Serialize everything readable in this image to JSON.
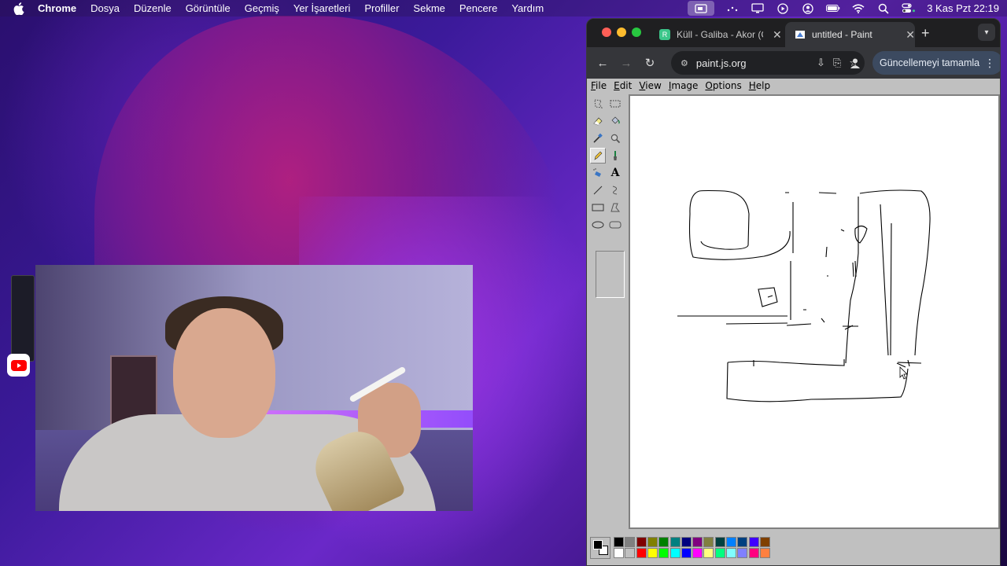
{
  "menubar": {
    "app_name": "Chrome",
    "items": [
      "Dosya",
      "Düzenle",
      "Görüntüle",
      "Geçmiş",
      "Yer İşaretleri",
      "Profiller",
      "Sekme",
      "Pencere",
      "Yardım"
    ],
    "clock": "3 Kas Pzt  22:19",
    "status_icons": [
      "screen-share-icon",
      "control-center-dots-icon",
      "display-icon",
      "play-icon",
      "user-icon",
      "battery-icon",
      "wifi-icon",
      "search-icon",
      "control-center-icon"
    ]
  },
  "browser": {
    "tabs": [
      {
        "title": "Küll - Galiba - Akor (G",
        "favicon": "R",
        "favicon_color": "#3cc68a",
        "active": false
      },
      {
        "title": "untitled - Paint",
        "favicon": "paint-icon",
        "active": true
      }
    ],
    "url": "paint.js.org",
    "update_button": "Güncellemeyi tamamla"
  },
  "paint": {
    "menu": [
      "File",
      "Edit",
      "View",
      "Image",
      "Options",
      "Help"
    ],
    "tools": [
      "free-select",
      "rect-select",
      "eraser",
      "fill",
      "color-picker",
      "magnifier",
      "pencil",
      "brush",
      "airbrush",
      "text",
      "line",
      "curve",
      "rectangle",
      "polygon",
      "ellipse",
      "rounded-rect"
    ],
    "selected_tool": "pencil",
    "palette_top": [
      "#000000",
      "#808080",
      "#800000",
      "#808000",
      "#008000",
      "#008080",
      "#000080",
      "#800080",
      "#808040",
      "#004040",
      "#0080ff",
      "#004080",
      "#4000ff",
      "#804000"
    ],
    "palette_bottom": [
      "#ffffff",
      "#c0c0c0",
      "#ff0000",
      "#ffff00",
      "#00ff00",
      "#00ffff",
      "#0000ff",
      "#ff00ff",
      "#ffff80",
      "#00ff80",
      "#80ffff",
      "#8080ff",
      "#ff0080",
      "#ff8040"
    ]
  }
}
